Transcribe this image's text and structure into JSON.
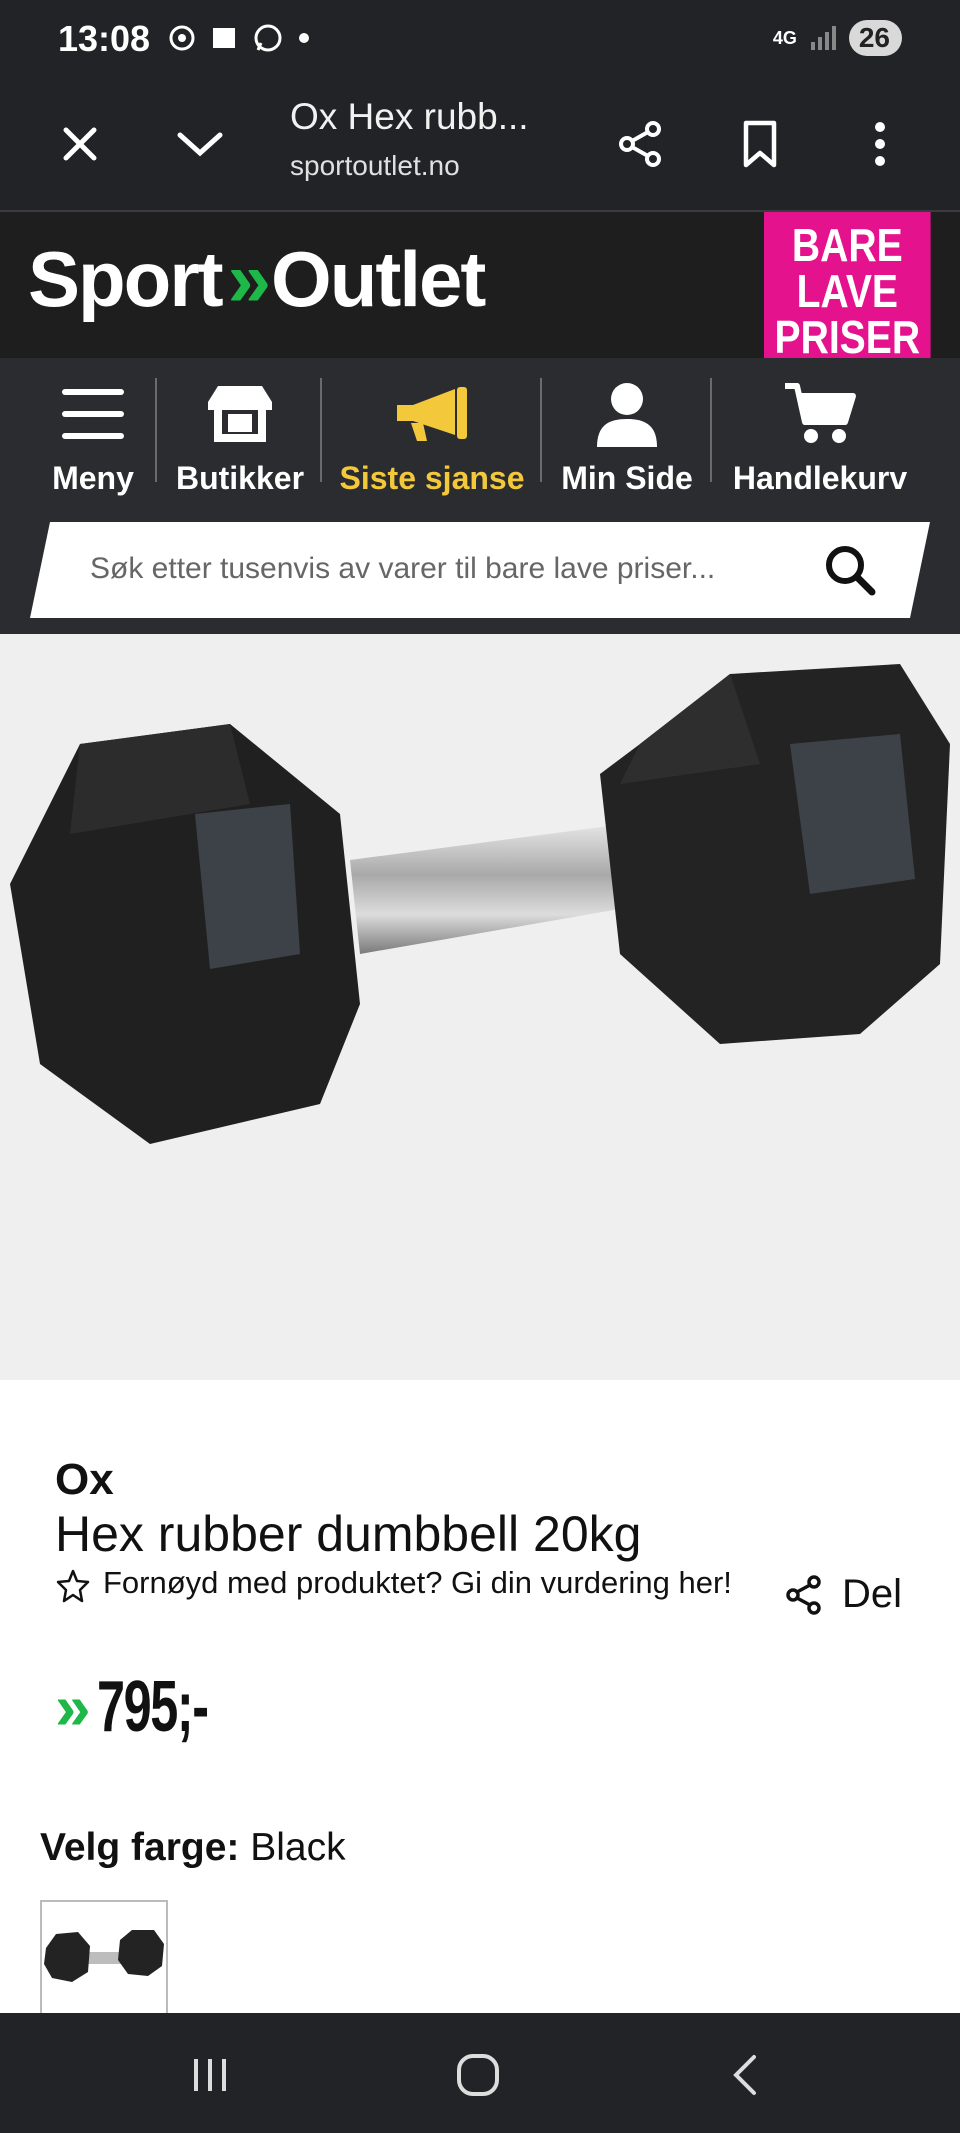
{
  "status_bar": {
    "time": "13:08",
    "network": "4G",
    "battery": "26"
  },
  "browser": {
    "title": "Ox Hex rubb...",
    "url": "sportoutlet.no",
    "icons": [
      "close-icon",
      "chevron-down-icon",
      "share-icon",
      "bookmark-icon",
      "more-vert-icon"
    ]
  },
  "header": {
    "logo_left": "Sport",
    "logo_arrows": "»",
    "logo_right": "Outlet",
    "promo_line1": "BARE",
    "promo_line2": "LAVE",
    "promo_line3": "PRISER",
    "brand_green": "#1db847",
    "promo_pink": "#e5128d"
  },
  "nav": {
    "items": [
      {
        "label": "Meny",
        "icon": "menu-icon"
      },
      {
        "label": "Butikker",
        "icon": "store-icon"
      },
      {
        "label": "Siste sjanse",
        "icon": "megaphone-icon",
        "color": "#f3c93b"
      },
      {
        "label": "Min Side",
        "icon": "user-icon"
      },
      {
        "label": "Handlekurv",
        "icon": "cart-icon"
      }
    ]
  },
  "search": {
    "placeholder": "Søk etter tusenvis av varer til bare lave priser..."
  },
  "product": {
    "brand": "Ox",
    "name": "Hex rubber dumbbell 20kg",
    "rating_prompt": "Fornøyd med produktet? Gi din vurdering her!",
    "share_label": "Del",
    "price_arrows": "»",
    "price": "795;-",
    "color_label": "Velg farge:",
    "color_value": "Black"
  }
}
